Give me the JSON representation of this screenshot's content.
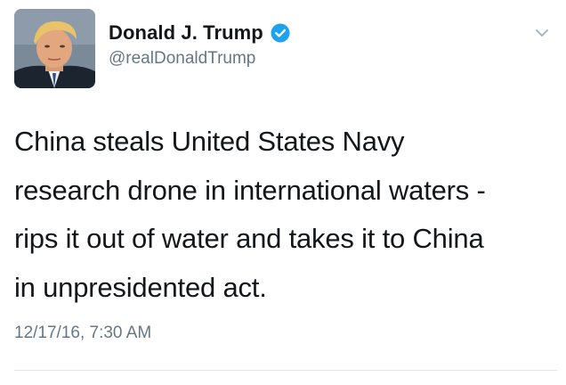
{
  "author": {
    "display_name": "Donald J. Trump",
    "handle": "@realDonaldTrump",
    "verified": true,
    "avatar_icon": "profile-photo"
  },
  "tweet": {
    "text_lines": [
      "China steals United States Navy",
      "research drone in international waters -",
      "rips it out of water and takes it to China",
      "in unpresidented act."
    ],
    "timestamp": "12/17/16, 7:30 AM"
  },
  "colors": {
    "verified_badge": "#1da1f2",
    "secondary_text": "#657786",
    "primary_text": "#14171a",
    "divider": "#e1e8ed"
  },
  "icons": {
    "verified": "verified-badge-icon",
    "menu": "chevron-down-icon"
  }
}
